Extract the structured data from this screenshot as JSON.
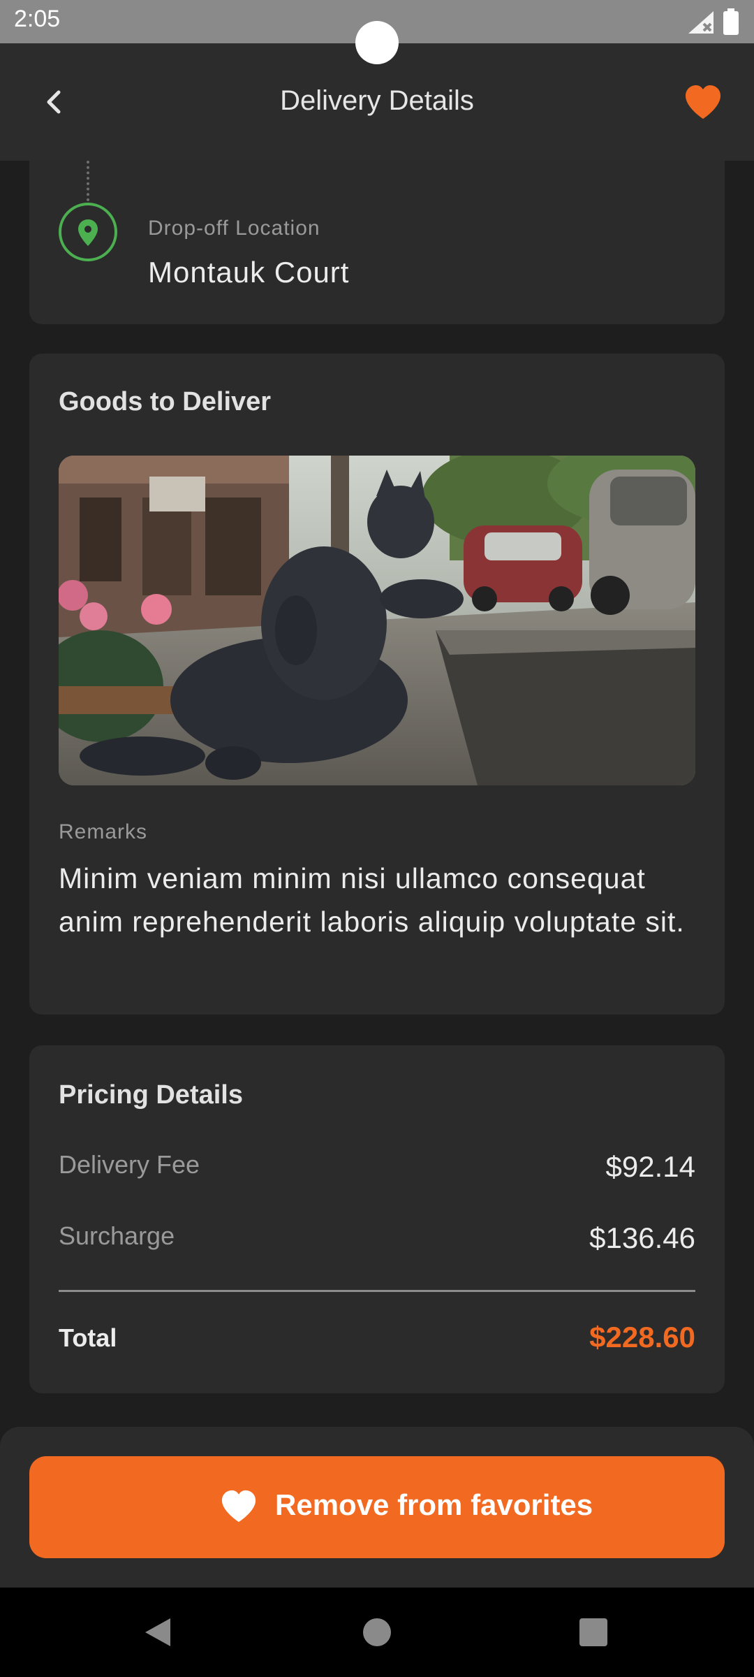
{
  "status_bar": {
    "time": "2:05"
  },
  "app_bar": {
    "title": "Delivery Details"
  },
  "dropoff": {
    "label": "Drop-off Location",
    "value": "Montauk Court"
  },
  "goods": {
    "heading": "Goods to Deliver",
    "image_subject": "cat statue photo",
    "remarks_label": "Remarks",
    "remarks_text": "Minim veniam minim nisi ullamco consequat anim reprehenderit laboris aliquip voluptate sit."
  },
  "pricing": {
    "heading": "Pricing Details",
    "rows": [
      {
        "label": "Delivery Fee",
        "value": "$92.14"
      },
      {
        "label": "Surcharge",
        "value": "$136.46"
      }
    ],
    "total_label": "Total",
    "total_value": "$228.60"
  },
  "action": {
    "remove_label": "Remove from favorites"
  },
  "colors": {
    "accent": "#f26a21",
    "location_pin": "#4caf50",
    "card_background": "#2b2b2b",
    "page_background": "#1e1e1e"
  },
  "icons": {
    "back": "chevron-left-icon",
    "favorite": "heart-icon",
    "location": "map-pin-icon",
    "signal": "signal-icon",
    "battery": "battery-icon"
  }
}
